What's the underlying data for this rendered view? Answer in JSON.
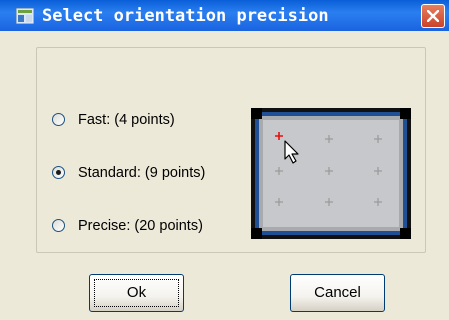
{
  "window": {
    "title": "Select orientation precision",
    "icon": "app-window-icon"
  },
  "options": [
    {
      "label": "Fast: (4 points)",
      "selected": false
    },
    {
      "label": "Standard: (9 points)",
      "selected": true
    },
    {
      "label": "Precise: (20 points)",
      "selected": false
    }
  ],
  "preview": {
    "grid_rows": 3,
    "grid_cols": 3,
    "highlighted_point": "top-left"
  },
  "buttons": {
    "ok_label": "Ok",
    "cancel_label": "Cancel"
  }
}
